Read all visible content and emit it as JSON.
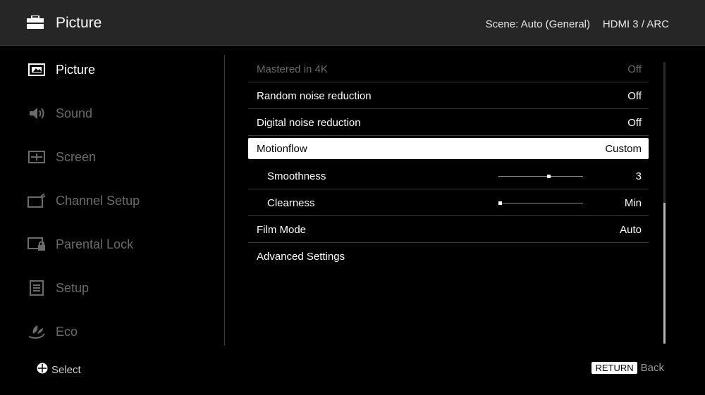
{
  "header": {
    "title": "Picture",
    "scene": "Scene: Auto (General)",
    "input": "HDMI 3 / ARC",
    "icon": "briefcase-icon"
  },
  "sidebar": {
    "items": [
      {
        "label": "Picture",
        "icon": "picture-icon",
        "active": true
      },
      {
        "label": "Sound",
        "icon": "speaker-icon",
        "active": false
      },
      {
        "label": "Screen",
        "icon": "screen-icon",
        "active": false
      },
      {
        "label": "Channel Setup",
        "icon": "antenna-tv-icon",
        "active": false
      },
      {
        "label": "Parental Lock",
        "icon": "lock-tv-icon",
        "active": false
      },
      {
        "label": "Setup",
        "icon": "setup-icon",
        "active": false
      },
      {
        "label": "Eco",
        "icon": "leaf-hand-icon",
        "active": false
      }
    ]
  },
  "settings": {
    "rows": [
      {
        "label": "Mastered in 4K",
        "value": "Off",
        "disabled": true
      },
      {
        "label": "Random noise reduction",
        "value": "Off"
      },
      {
        "label": "Digital noise reduction",
        "value": "Off"
      },
      {
        "label": "Motionflow",
        "value": "Custom",
        "focused": true
      },
      {
        "label": "Smoothness",
        "value": "3",
        "slider_level": 0.6
      },
      {
        "label": "Clearness",
        "value": "Min",
        "slider_level": 0.0
      },
      {
        "label": "Film Mode",
        "value": "Auto"
      },
      {
        "label": "Advanced Settings",
        "value": ""
      }
    ]
  },
  "scroll": {
    "thumb_start": 0.5,
    "thumb_end": 1.0
  },
  "footer": {
    "select_label": "Select",
    "return_key": "RETURN",
    "back_label": "Back"
  },
  "colors": {
    "background": "#000000",
    "header_bg": "#262626",
    "focus_bg": "#ffffff",
    "dim_text": "#6b6b6b"
  }
}
